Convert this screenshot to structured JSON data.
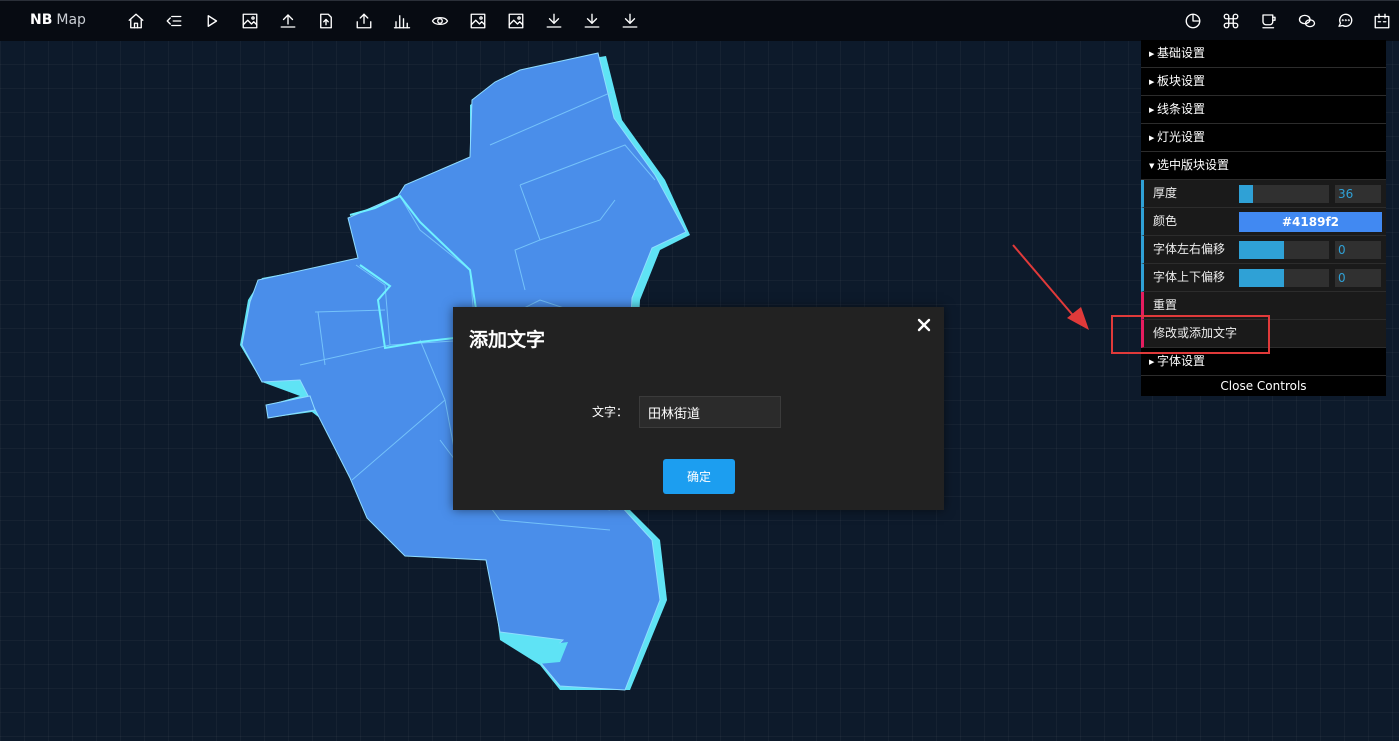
{
  "app": {
    "logo_bold": "NB",
    "logo_rest": "Map"
  },
  "toolbar": {
    "left_icons": [
      "home-icon",
      "list-icon",
      "play-icon",
      "image-icon",
      "upload-icon",
      "file-upload-icon",
      "upload-tray-icon",
      "bar-chart-icon",
      "eye-icon",
      "image-icon",
      "image-icon",
      "download-icon",
      "download-icon",
      "download-icon"
    ],
    "right_icons": [
      "pie-chart-icon",
      "command-icon",
      "coffee-icon",
      "wechat-icon",
      "message-icon",
      "calendar-icon"
    ]
  },
  "controls": {
    "folders_top": [
      "基础设置",
      "板块设置",
      "线条设置",
      "灯光设置"
    ],
    "selected_folder": "选中版块设置",
    "thickness": {
      "label": "厚度",
      "value": "36",
      "fill": 0.15
    },
    "color": {
      "label": "颜色",
      "value": "#4189f2"
    },
    "offset_x": {
      "label": "字体左右偏移",
      "value": "0",
      "fill": 0.5
    },
    "offset_y": {
      "label": "字体上下偏移",
      "value": "0",
      "fill": 0.5
    },
    "reset_label": "重置",
    "edit_text_label": "修改或添加文字",
    "font_folder": "字体设置",
    "close_label": "Close Controls"
  },
  "dialog": {
    "title": "添加文字",
    "field_label": "文字：",
    "field_value": "田林街道",
    "confirm_label": "确定"
  },
  "colors": {
    "region_fill": "#4a8eea",
    "region_edge": "#7fd9ff",
    "accent": "#2fa1d6",
    "button": "#1c9ef0"
  }
}
